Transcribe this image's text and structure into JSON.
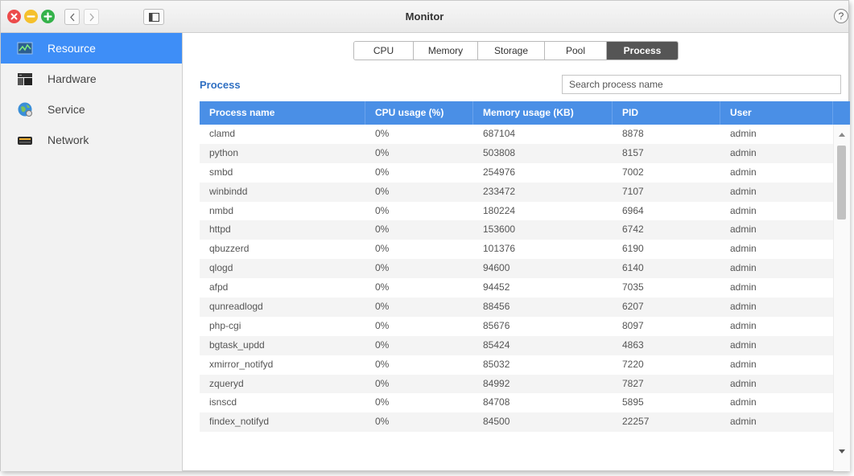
{
  "window": {
    "title": "Monitor",
    "help": "?"
  },
  "sidebar": {
    "items": [
      {
        "label": "Resource",
        "icon": "resource-monitor-icon",
        "active": true
      },
      {
        "label": "Hardware",
        "icon": "hardware-icon",
        "active": false
      },
      {
        "label": "Service",
        "icon": "service-globe-icon",
        "active": false
      },
      {
        "label": "Network",
        "icon": "network-icon",
        "active": false
      }
    ]
  },
  "tabs": [
    {
      "label": "CPU",
      "active": false
    },
    {
      "label": "Memory",
      "active": false
    },
    {
      "label": "Storage",
      "active": false
    },
    {
      "label": "Pool",
      "active": false
    },
    {
      "label": "Process",
      "active": true
    }
  ],
  "section_title": "Process",
  "search": {
    "placeholder": "Search process name",
    "value": ""
  },
  "table": {
    "columns": [
      "Process name",
      "CPU usage (%)",
      "Memory usage (KB)",
      "PID",
      "User"
    ],
    "rows": [
      [
        "clamd",
        "0%",
        "687104",
        "8878",
        "admin"
      ],
      [
        "python",
        "0%",
        "503808",
        "8157",
        "admin"
      ],
      [
        "smbd",
        "0%",
        "254976",
        "7002",
        "admin"
      ],
      [
        "winbindd",
        "0%",
        "233472",
        "7107",
        "admin"
      ],
      [
        "nmbd",
        "0%",
        "180224",
        "6964",
        "admin"
      ],
      [
        "httpd",
        "0%",
        "153600",
        "6742",
        "admin"
      ],
      [
        "qbuzzerd",
        "0%",
        "101376",
        "6190",
        "admin"
      ],
      [
        "qlogd",
        "0%",
        "94600",
        "6140",
        "admin"
      ],
      [
        "afpd",
        "0%",
        "94452",
        "7035",
        "admin"
      ],
      [
        "qunreadlogd",
        "0%",
        "88456",
        "6207",
        "admin"
      ],
      [
        "php-cgi",
        "0%",
        "85676",
        "8097",
        "admin"
      ],
      [
        "bgtask_updd",
        "0%",
        "85424",
        "4863",
        "admin"
      ],
      [
        "xmirror_notifyd",
        "0%",
        "85032",
        "7220",
        "admin"
      ],
      [
        "zqueryd",
        "0%",
        "84992",
        "7827",
        "admin"
      ],
      [
        "isnscd",
        "0%",
        "84708",
        "5895",
        "admin"
      ],
      [
        "findex_notifyd",
        "0%",
        "84500",
        "22257",
        "admin"
      ]
    ]
  },
  "colors": {
    "accent": "#3e8ef7",
    "header": "#4a8fe6",
    "title_link": "#2f6fc2"
  }
}
